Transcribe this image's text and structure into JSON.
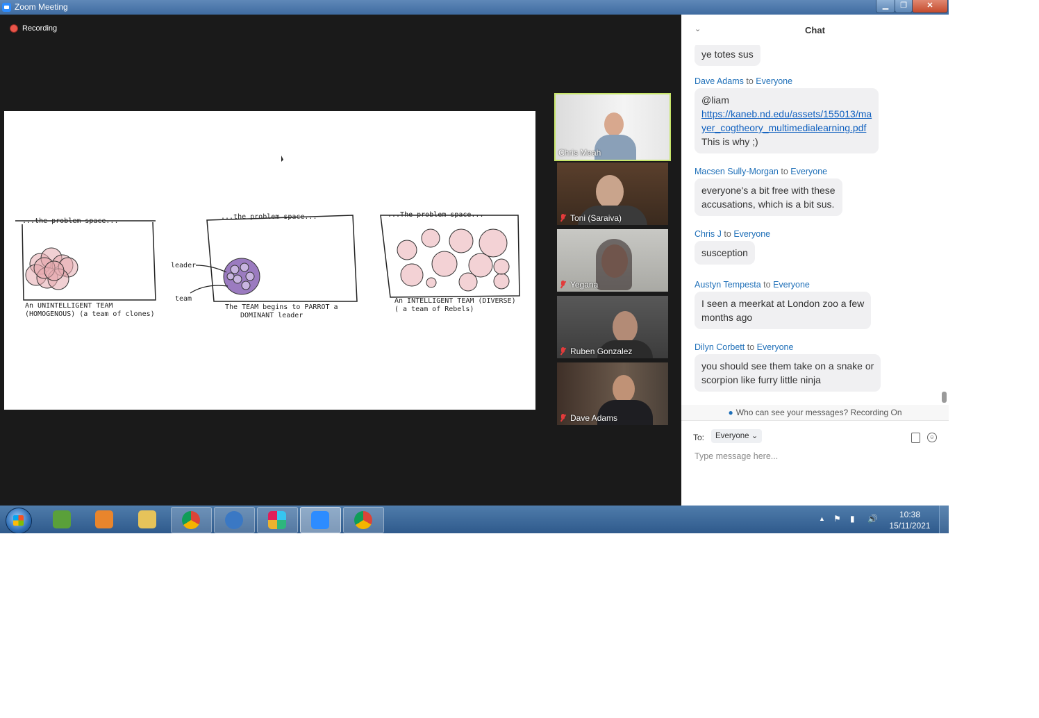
{
  "window": {
    "title": "Zoom Meeting",
    "min": "▁",
    "max": "❐",
    "close": "✕"
  },
  "recording": {
    "label": "Recording"
  },
  "slide": {
    "panels": [
      {
        "header": "...the problem space...",
        "caption1": "An UNINTELLIGENT TEAM",
        "caption2": "(HOMOGENOUS) (a team of clones)"
      },
      {
        "header": "...the problem space...",
        "caption1": "The TEAM begins to PARROT a",
        "caption2": "DOMINANT leader"
      },
      {
        "header": "...The problem space...",
        "caption1": "An INTELLIGENT TEAM (DIVERSE)",
        "caption2": "( a team of Rebels)"
      }
    ],
    "leader_label": "leader",
    "team_label": "team"
  },
  "participants": [
    {
      "name": "Chris Meah",
      "muted": false
    },
    {
      "name": "Toni (Saraiva)",
      "muted": true
    },
    {
      "name": "Yegana",
      "muted": true
    },
    {
      "name": "Ruben Gonzalez",
      "muted": true
    },
    {
      "name": "Dave Adams",
      "muted": true
    }
  ],
  "chat": {
    "title": "Chat",
    "messages": [
      {
        "text": "ye totes sus"
      },
      {
        "sender": "Dave Adams",
        "to_word": "to",
        "recipient": "Everyone",
        "line1": "@liam",
        "link1": "https://kaneb.nd.edu/assets/155013/ma",
        "link2": "yer_cogtheory_multimedialearning.pdf",
        "line2": "This is why ;)"
      },
      {
        "sender": "Macsen Sully-Morgan",
        "to_word": "to",
        "recipient": "Everyone",
        "line1": "everyone's a bit free with these",
        "line2": "accusations, which is a bit sus."
      },
      {
        "sender": "Chris J",
        "to_word": "to",
        "recipient": "Everyone",
        "line1": "susception"
      },
      {
        "sender": "Austyn Tempesta",
        "to_word": "to",
        "recipient": "Everyone",
        "line1": "I seen a meerkat at London zoo a few",
        "line2": "months ago"
      },
      {
        "sender": "Dilyn Corbett",
        "to_word": "to",
        "recipient": "Everyone",
        "line1": "you should see them take on a snake or",
        "line2": "scorpion like furry little ninja"
      }
    ],
    "privacy_note": "Who can see your messages? Recording On",
    "to_label": "To:",
    "to_value": "Everyone",
    "input_placeholder": "Type message here..."
  },
  "taskbar": {
    "apps": [
      "evernote-icon",
      "media-player-icon",
      "file-explorer-icon",
      "chrome-icon",
      "thunderbird-icon",
      "slack-icon",
      "zoom-icon",
      "chrome-profile-icon"
    ],
    "time": "10:38",
    "date": "15/11/2021"
  },
  "colors": {
    "accent": "#1e6fb8",
    "speaker_border": "#c7e56a",
    "recording": "#e8554a",
    "meeting_bg": "#1a1a1a"
  }
}
